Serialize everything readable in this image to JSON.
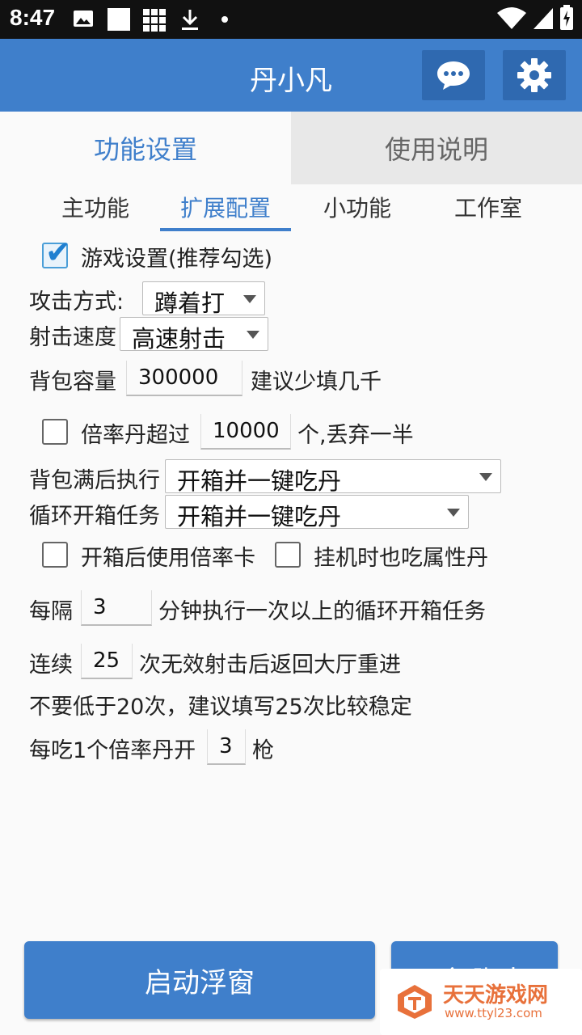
{
  "status": {
    "time": "8:47"
  },
  "appbar": {
    "title": "丹小凡"
  },
  "main_tabs": [
    {
      "label": "功能设置",
      "active": true
    },
    {
      "label": "使用说明",
      "active": false
    }
  ],
  "sub_tabs": [
    {
      "label": "主功能"
    },
    {
      "label": "扩展配置",
      "active": true
    },
    {
      "label": "小功能"
    },
    {
      "label": "工作室"
    }
  ],
  "settings": {
    "game_settings_label": "游戏设置(推荐勾选)",
    "attack_mode_label": "攻击方式:",
    "attack_mode_value": "蹲着打",
    "fire_speed_label": "射击速度",
    "fire_speed_value": "高速射击",
    "bag_capacity_label": "背包容量",
    "bag_capacity_value": "300000",
    "bag_capacity_hint": "建议少填几千",
    "multiplier_label": "倍率丹超过",
    "multiplier_value": "10000",
    "multiplier_suffix": "个,丢弃一半",
    "bag_full_label": "背包满后执行",
    "bag_full_value": "开箱并一键吃丹",
    "loop_task_label": "循环开箱任务",
    "loop_task_value": "开箱并一键吃丹",
    "use_card_label": "开箱后使用倍率卡",
    "eat_attr_label": "挂机时也吃属性丹",
    "interval_label": "每隔",
    "interval_value": "3",
    "interval_suffix": "分钟执行一次以上的循环开箱任务",
    "continuous_label": "连续",
    "continuous_value": "25",
    "continuous_suffix": "次无效射击后返回大厅重进",
    "continuous_note": "不要低于20次，建议填写25次比较稳定",
    "shots_label": "每吃1个倍率丹开",
    "shots_value": "3",
    "shots_suffix": "枪"
  },
  "buttons": {
    "start_float": "启动浮窗",
    "run_script": "运行脚本"
  },
  "watermark": {
    "title": "天天游戏网",
    "url": "www.ttyl23.com"
  },
  "colors": {
    "primary": "#3f7fcb",
    "status_bar": "#111111",
    "accent": "#e8713b"
  }
}
